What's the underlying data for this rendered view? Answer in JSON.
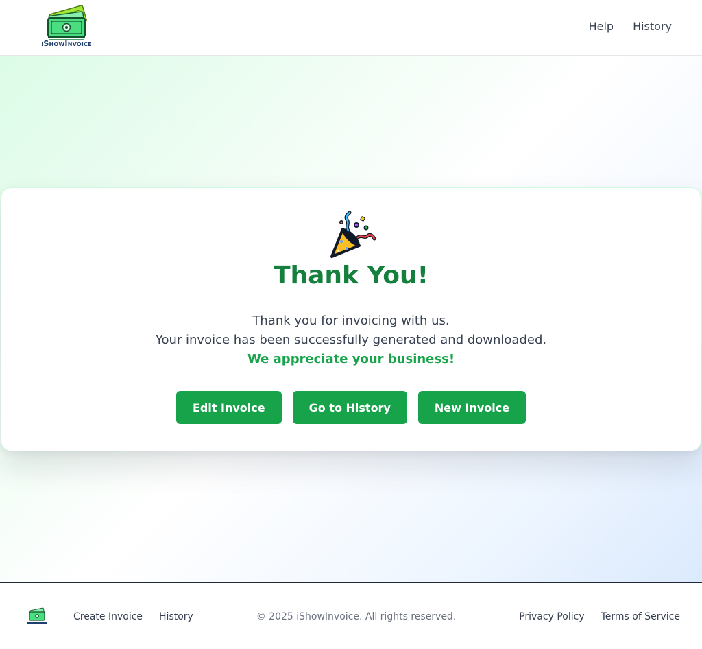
{
  "header": {
    "brand_name": "iShowInvoice",
    "nav": {
      "help": "Help",
      "history": "History"
    }
  },
  "main": {
    "title": "Thank You!",
    "message_line1": "Thank you for invoicing with us.",
    "message_line2": "Your invoice has been successfully generated and downloaded.",
    "message_highlight": "We appreciate your business!",
    "buttons": {
      "edit": "Edit Invoice",
      "history": "Go to History",
      "new": "New Invoice"
    }
  },
  "footer": {
    "links_left": {
      "create": "Create Invoice",
      "history": "History"
    },
    "copyright": "© 2025 iShowInvoice. All rights reserved.",
    "links_right": {
      "privacy": "Privacy Policy",
      "terms": "Terms of Service"
    }
  },
  "icons": {
    "logo": "money-stack-icon",
    "celebration": "party-popper-icon"
  },
  "colors": {
    "accent": "#16a34a",
    "title": "#15803d",
    "text": "#374151",
    "muted": "#6b7280"
  }
}
